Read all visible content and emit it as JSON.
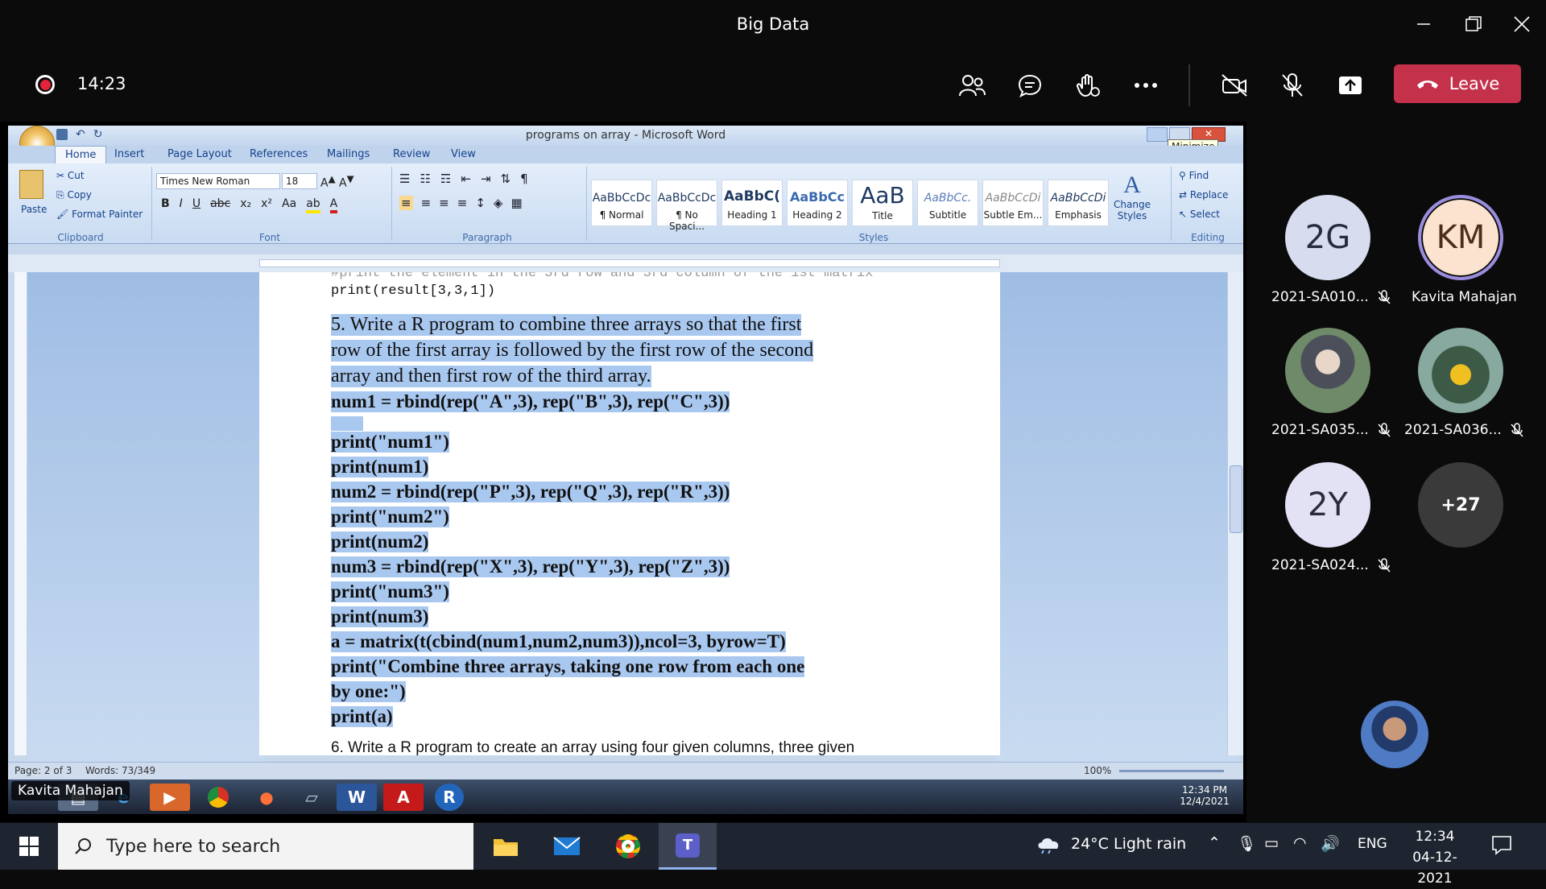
{
  "window": {
    "title": "Big Data"
  },
  "meeting": {
    "timer": "14:23",
    "leave_label": "Leave",
    "presenter_label": "Kavita Mahajan"
  },
  "word": {
    "title": "programs on array - Microsoft Word",
    "tabs": [
      "Home",
      "Insert",
      "Page Layout",
      "References",
      "Mailings",
      "Review",
      "View"
    ],
    "clipboard": {
      "paste": "Paste",
      "cut": "Cut",
      "copy": "Copy",
      "format_painter": "Format Painter",
      "group": "Clipboard"
    },
    "font": {
      "name": "Times New Roman",
      "size": "18",
      "group": "Font"
    },
    "paragraph_group": "Paragraph",
    "styles": [
      {
        "sample": "AaBbCcDc",
        "name": "¶ Normal"
      },
      {
        "sample": "AaBbCcDc",
        "name": "¶ No Spaci..."
      },
      {
        "sample": "AaBbC(",
        "name": "Heading 1"
      },
      {
        "sample": "AaBbCc",
        "name": "Heading 2"
      },
      {
        "sample": "AaB",
        "name": "Title"
      },
      {
        "sample": "AaBbCc.",
        "name": "Subtitle"
      },
      {
        "sample": "AaBbCcDi",
        "name": "Subtle Em..."
      },
      {
        "sample": "AaBbCcDi",
        "name": "Emphasis"
      }
    ],
    "styles_group": "Styles",
    "change_styles": "Change Styles",
    "editing": {
      "find": "Find",
      "replace": "Replace",
      "select": "Select",
      "group": "Editing"
    },
    "tooltip": "Minimize",
    "doc": {
      "cut_line": "print(result[3,3,1])",
      "para5": [
        "5. Write a R program to combine three arrays so that the first",
        "row of the first array is followed by the first row of the second",
        "array and then first row of the third array."
      ],
      "code": [
        "num1 = rbind(rep(\"A\",3), rep(\"B\",3), rep(\"C\",3))",
        "",
        "print(\"num1\")",
        "print(num1)",
        "num2 = rbind(rep(\"P\",3), rep(\"Q\",3), rep(\"R\",3))",
        "print(\"num2\")",
        "print(num2)",
        "num3 = rbind(rep(\"X\",3), rep(\"Y\",3), rep(\"Z\",3))",
        "print(\"num3\")",
        "print(num3)",
        "a = matrix(t(cbind(num1,num2,num3)),ncol=3, byrow=T)",
        "print(\"Combine three arrays, taking one row from each one",
        "by one:\")",
        "print(a)"
      ],
      "para6": "6. Write a R program to create an array using four given columns, three given"
    },
    "status": {
      "page": "Page: 2 of 3",
      "words": "Words: 73/349",
      "zoom": "100%"
    },
    "xp_clock": {
      "time": "12:34 PM",
      "date": "12/4/2021"
    }
  },
  "participants": [
    {
      "initials": "2G",
      "name": "2021-SA010...",
      "muted": true
    },
    {
      "initials": "KM",
      "name": "Kavita Mahajan",
      "muted": false
    },
    {
      "initials": "",
      "name": "2021-SA035...",
      "muted": true
    },
    {
      "initials": "",
      "name": "2021-SA036...",
      "muted": true
    },
    {
      "initials": "2Y",
      "name": "2021-SA024...",
      "muted": true
    },
    {
      "initials": "+27",
      "name": "",
      "muted": false
    }
  ],
  "taskbar": {
    "search_placeholder": "Type here to search",
    "weather": "24°C  Light rain",
    "lang": "ENG",
    "time": "12:34",
    "date": "04-12-2021"
  }
}
